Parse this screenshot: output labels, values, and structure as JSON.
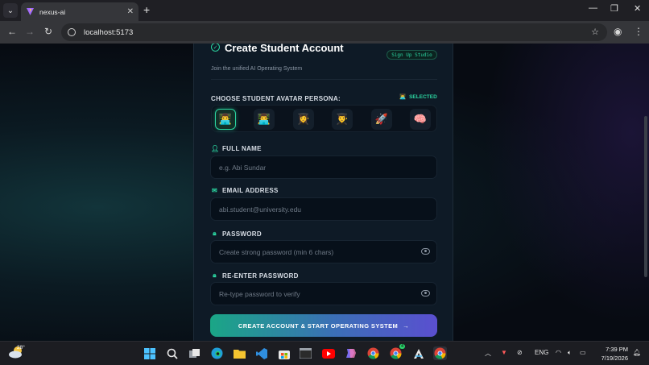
{
  "browser": {
    "tab_title": "nexus-ai",
    "url": "localhost:5173"
  },
  "card": {
    "title": "Create Student Account",
    "subtitle": "Join the unified AI Operating System",
    "badge": "Sign Up Studio",
    "avatar_label": "CHOOSE STUDENT AVATAR PERSONA:",
    "selected_label": "SELECTED",
    "avatars": [
      "👨‍💻",
      "👨‍💻",
      "👩‍🎓",
      "👨‍🎓",
      "🚀",
      "🧠"
    ],
    "full_name_label": "FULL NAME",
    "full_name_placeholder": "e.g. Abi Sundar",
    "email_label": "EMAIL ADDRESS",
    "email_placeholder": "abi.student@university.edu",
    "password_label": "PASSWORD",
    "password_placeholder": "Create strong password (min 6 chars)",
    "reenter_label": "RE-ENTER PASSWORD",
    "reenter_placeholder": "Re-type password to verify",
    "cta_label": "CREATE ACCOUNT & START OPERATING SYSTEM",
    "cta_arrow": "→"
  },
  "taskbar": {
    "temperature": "28°",
    "language": "ENG",
    "time": "7:39 PM",
    "date": "7/19/2026",
    "chrome_badge": "4"
  },
  "colors": {
    "accent": "#2bd4a0",
    "cta_start": "#1aa686",
    "cta_end": "#5a4fd0"
  }
}
